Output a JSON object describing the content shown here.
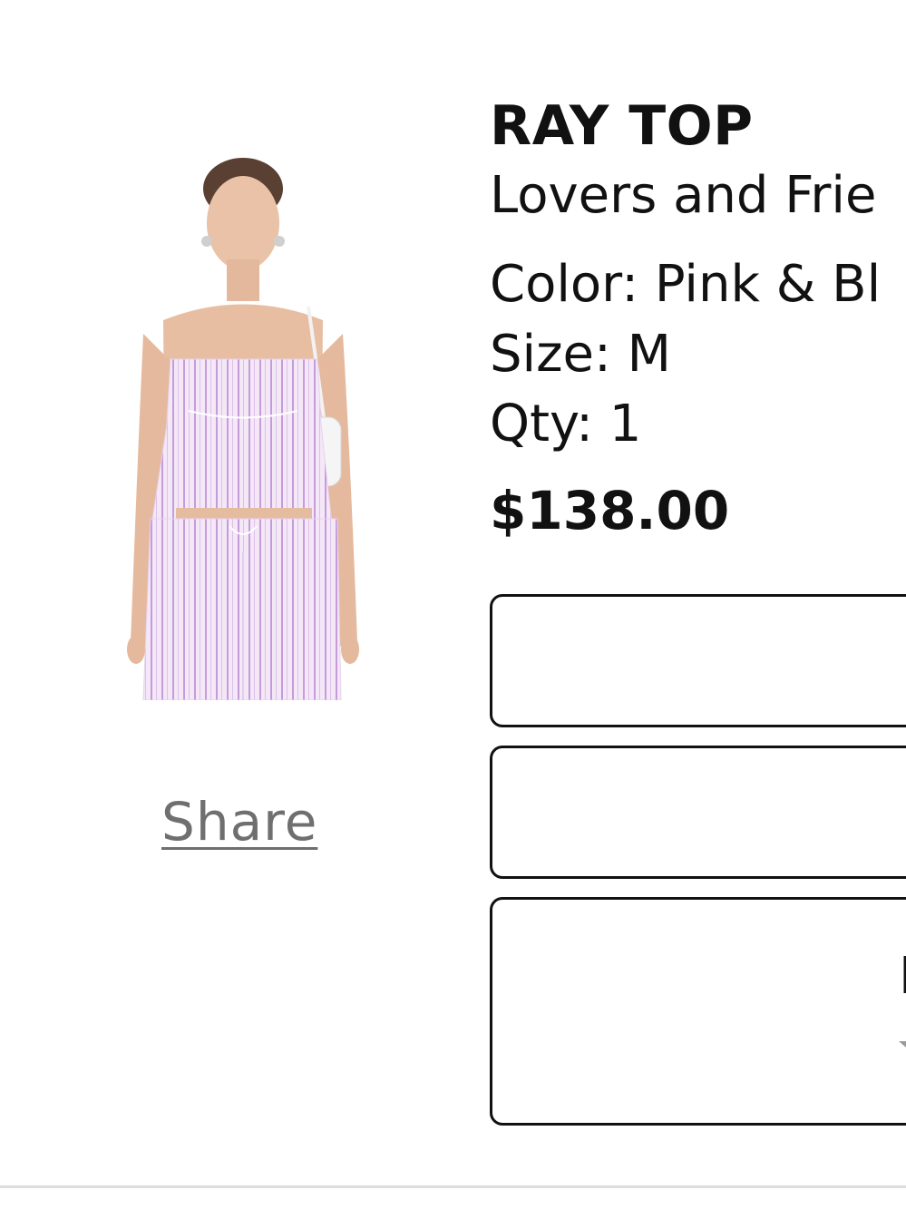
{
  "product": {
    "title": "RAY TOP",
    "brand": "Lovers and Frie",
    "color": "Color: Pink & Bl",
    "size": "Size: M",
    "qty": "Qty: 1",
    "price": "$138.00",
    "image_description_icon": "product-photo"
  },
  "share": {
    "label": "Share"
  },
  "actions": {
    "box3_partial_text": "F"
  },
  "colors": {
    "stripe_pink": "#c9a3e0",
    "fabric_base": "#f3e6f6",
    "text_main": "#111111",
    "share_gray": "#6f6f6f"
  }
}
